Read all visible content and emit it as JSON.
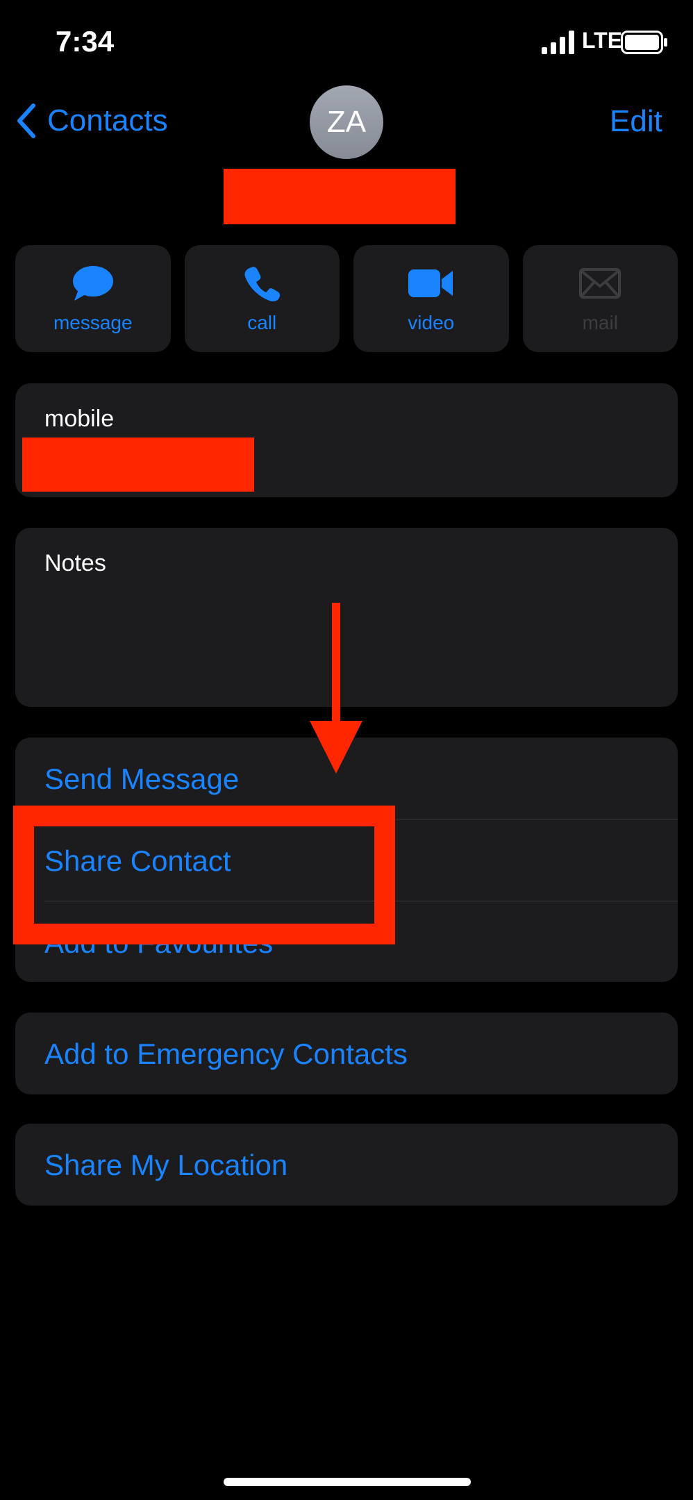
{
  "status_bar": {
    "time": "7:34",
    "network": "LTE"
  },
  "nav": {
    "back_label": "Contacts",
    "avatar_initials": "ZA",
    "edit_label": "Edit"
  },
  "actions": [
    {
      "label": "message",
      "icon": "message-bubble-icon",
      "enabled": true
    },
    {
      "label": "call",
      "icon": "phone-icon",
      "enabled": true
    },
    {
      "label": "video",
      "icon": "video-camera-icon",
      "enabled": true
    },
    {
      "label": "mail",
      "icon": "envelope-icon",
      "enabled": false
    }
  ],
  "phone": {
    "label": "mobile"
  },
  "notes": {
    "label": "Notes"
  },
  "options": [
    {
      "label": "Send Message"
    },
    {
      "label": "Share Contact"
    },
    {
      "label": "Add to Favourites"
    }
  ],
  "emergency": {
    "label": "Add to Emergency Contacts"
  },
  "location": {
    "label": "Share My Location"
  },
  "colors": {
    "accent": "#1a84ff",
    "annotation": "#ff2600",
    "card": "#1c1c1e",
    "background": "#000000"
  }
}
